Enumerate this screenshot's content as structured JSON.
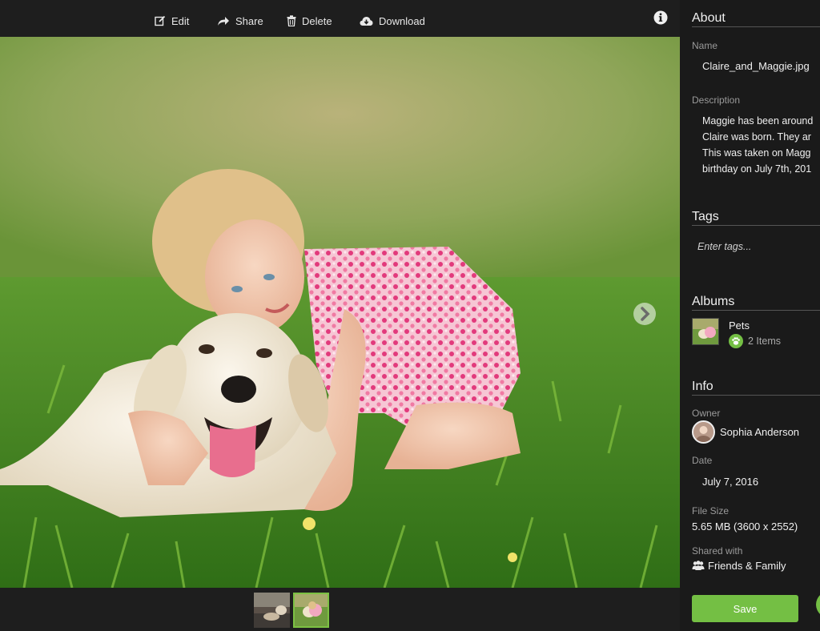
{
  "toolbar": {
    "edit_label": "Edit",
    "share_label": "Share",
    "delete_label": "Delete",
    "download_label": "Download",
    "info_icon": "info-icon"
  },
  "viewer": {
    "next_icon": "chevron-right-icon"
  },
  "filmstrip": {
    "thumbnails": [
      "thumb-1",
      "thumb-2"
    ],
    "selected_index": 1
  },
  "sidebar": {
    "about": {
      "title": "About",
      "name_label": "Name",
      "name_value": "Claire_and_Maggie.jpg",
      "description_label": "Description",
      "description_value": "Maggie has been around\nClaire was born. They ar\nThis was taken on Magg\nbirthday on July 7th, 201"
    },
    "tags": {
      "title": "Tags",
      "placeholder": "Enter tags..."
    },
    "albums": {
      "title": "Albums",
      "items": [
        {
          "name": "Pets",
          "count": "2 Items"
        }
      ]
    },
    "info": {
      "title": "Info",
      "owner_label": "Owner",
      "owner_value": "Sophia Anderson",
      "date_label": "Date",
      "date_value": "July 7, 2016",
      "filesize_label": "File Size",
      "filesize_value": "5.65 MB (3600 x 2552)",
      "shared_label": "Shared with",
      "shared_value": "Friends & Family"
    },
    "save_label": "Save"
  },
  "colors": {
    "accent": "#74bf44",
    "background": "#1a1a1a",
    "toolbar": "#1e1e1e"
  }
}
